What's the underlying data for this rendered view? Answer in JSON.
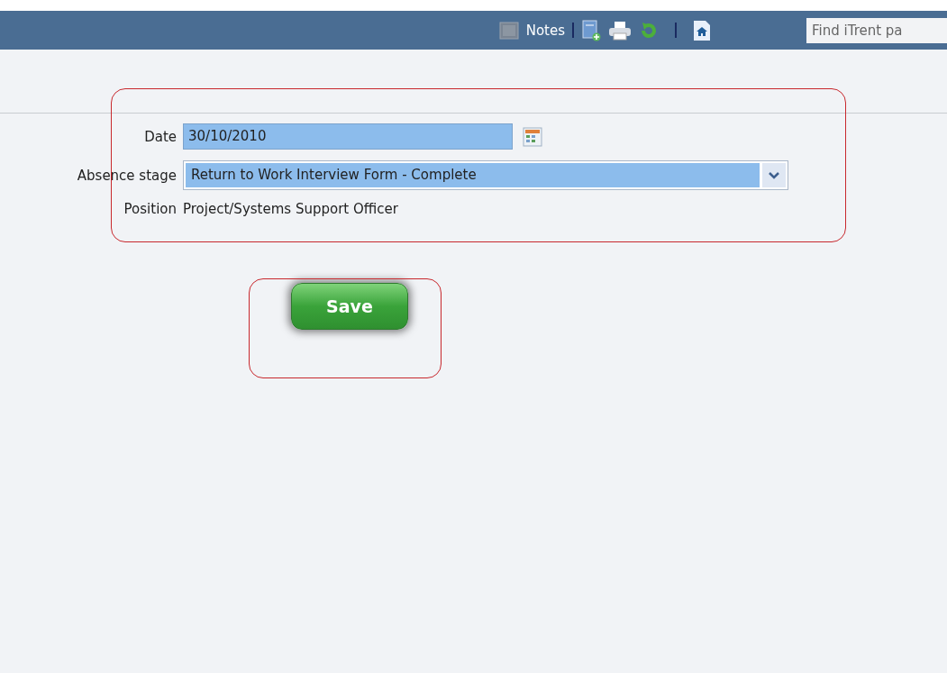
{
  "toolbar": {
    "notes_label": "Notes",
    "search": {
      "placeholder": "Find iTrent pa"
    }
  },
  "form": {
    "fields": [
      {
        "kind": "date",
        "label": "Date",
        "value": "30/10/2010"
      },
      {
        "kind": "select",
        "label": "Absence stage",
        "value": "Return to Work Interview Form - Complete"
      },
      {
        "kind": "text",
        "label": "Position",
        "value": "Project/Systems Support Officer"
      }
    ]
  },
  "save_button": "Save"
}
